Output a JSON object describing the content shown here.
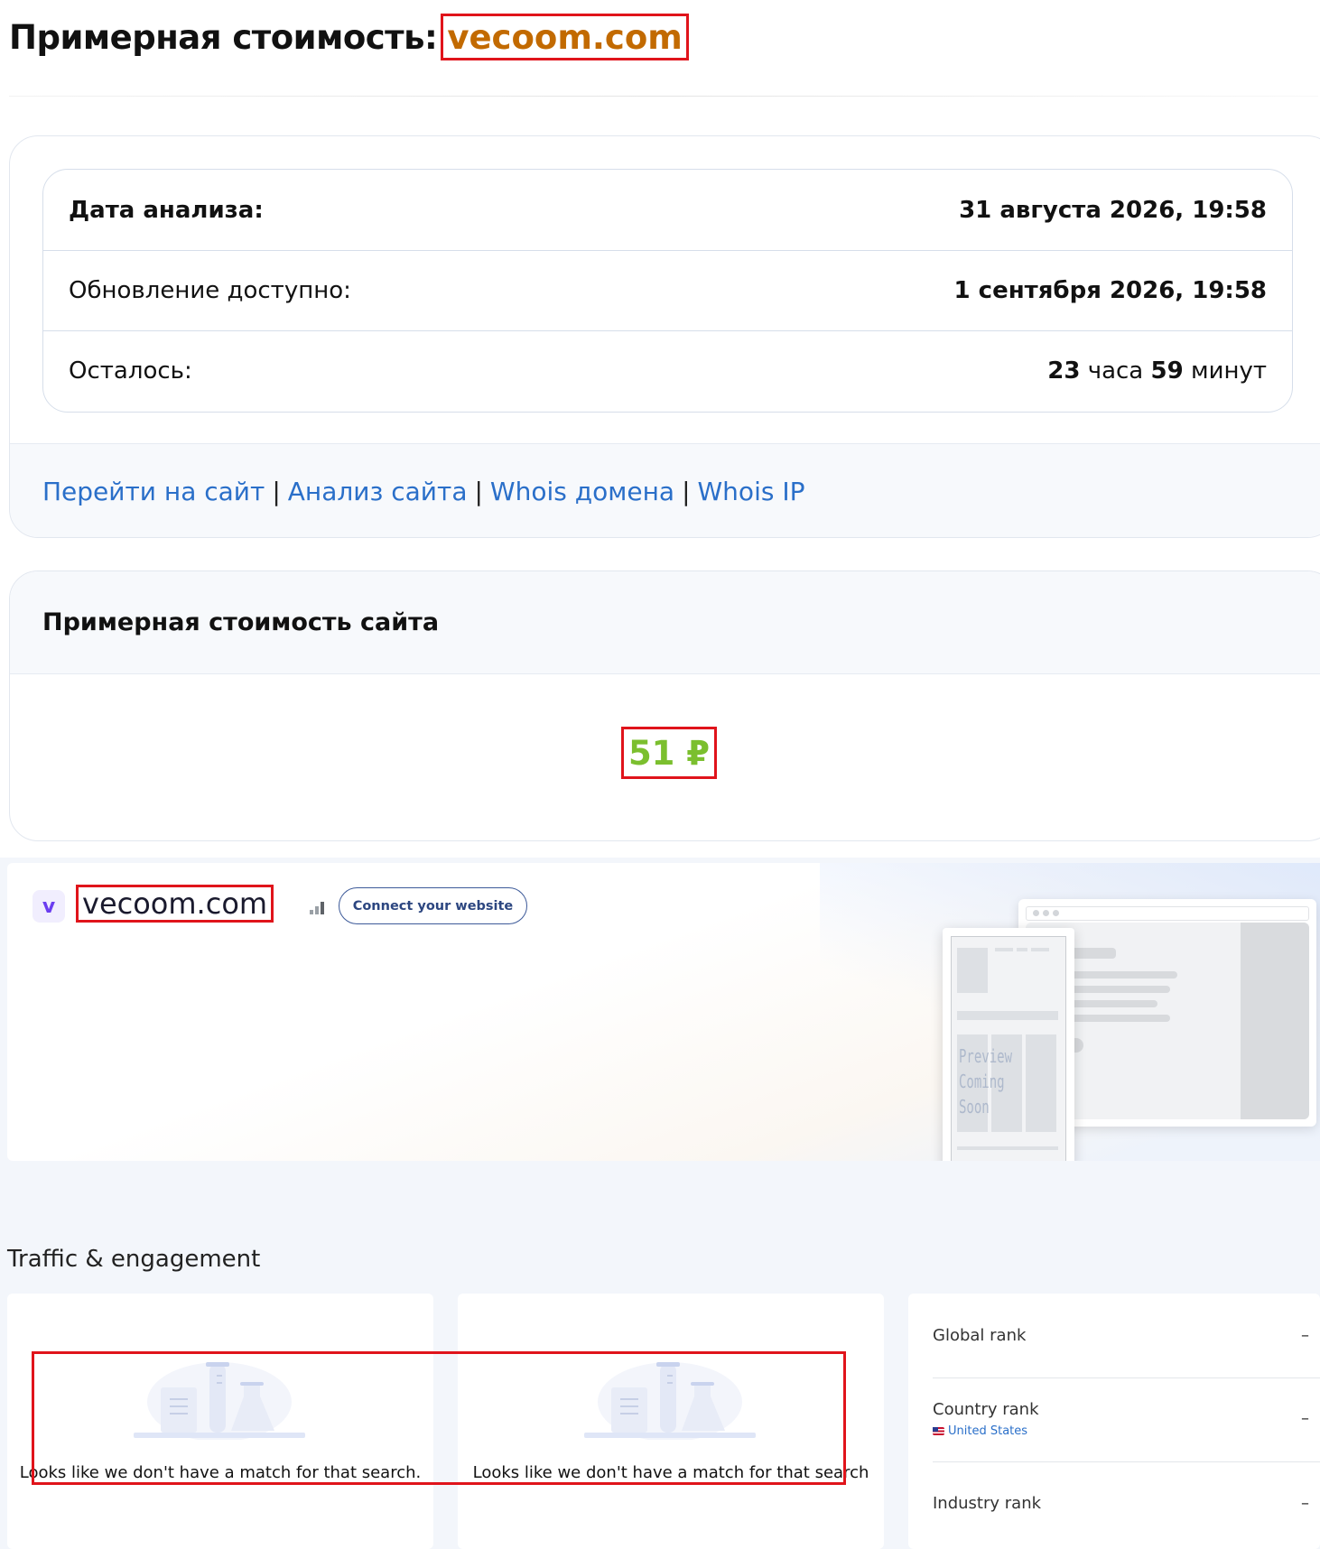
{
  "header": {
    "title": "Примерная стоимость:",
    "domain": "vecoom.com"
  },
  "analysis": {
    "rows": [
      {
        "label": "Дата анализа:",
        "value": "31 августа 2026, 19:58"
      },
      {
        "label": "Обновление доступно:",
        "value": "1 сентября 2026, 19:58"
      },
      {
        "label": "Осталось:",
        "hours": "23",
        "hours_unit": " часа ",
        "minutes": "59",
        "minutes_unit": " минут"
      }
    ],
    "links": [
      "Перейти на сайт",
      "Анализ сайта",
      "Whois домена",
      "Whois IP"
    ],
    "separator": "|"
  },
  "cost": {
    "title": "Примерная стоимость сайта",
    "price": "51 ₽"
  },
  "similarweb": {
    "icon_letter": "v",
    "domain": "vecoom.com",
    "connect_label": "Connect your website",
    "preview_text_1": "Preview",
    "preview_text_2": "Coming Soon"
  },
  "traffic": {
    "title": "Traffic & engagement",
    "empty_message_1": "Looks like we don't have a match for that search.",
    "empty_message_2": "Looks like we don't have a match for that search",
    "ranks": [
      {
        "label": "Global rank",
        "value": "–"
      },
      {
        "label": "Country rank",
        "sub": "United States",
        "value": "–"
      },
      {
        "label": "Industry rank",
        "value": "–"
      }
    ]
  },
  "colors": {
    "accent_domain": "#c26a00",
    "price_green": "#7bbf2e",
    "link_blue": "#2a6fc9",
    "highlight_red": "#e0141b"
  }
}
